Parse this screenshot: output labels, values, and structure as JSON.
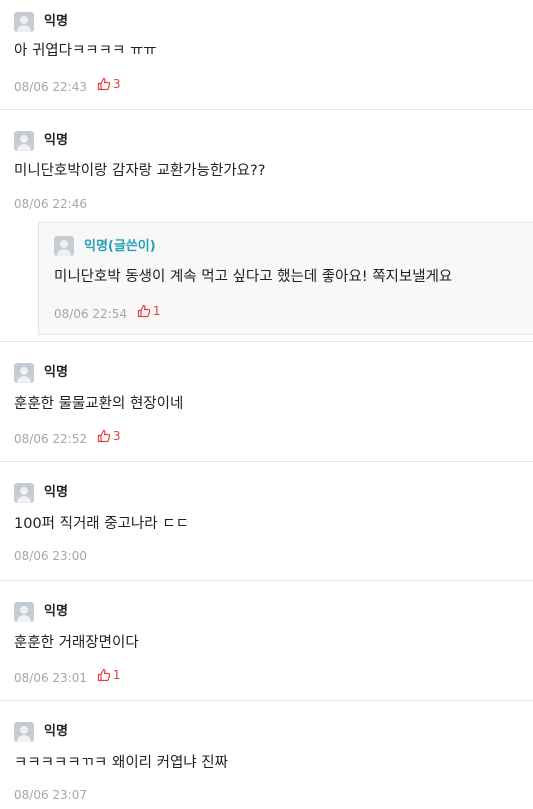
{
  "comments": [
    {
      "name": "익명",
      "text": "아 귀엽다ㅋㅋㅋㅋ ㅠㅠ",
      "date": "08/06 22:43",
      "votes": "3"
    },
    {
      "name": "익명",
      "text": "미니단호박이랑 감자랑 교환가능한가요??",
      "date": "08/06 22:46",
      "votes": ""
    },
    {
      "name": "익명(글쓴이)",
      "text": "미니단호박 동생이 계속 먹고 싶다고 했는데 좋아요! 쪽지보낼게요",
      "date": "08/06 22:54",
      "votes": "1"
    },
    {
      "name": "익명",
      "text": "훈훈한 물물교환의 현장이네",
      "date": "08/06 22:52",
      "votes": "3"
    },
    {
      "name": "익명",
      "text": "100퍼 직거래 중고나라 ㄷㄷ",
      "date": "08/06 23:00",
      "votes": ""
    },
    {
      "name": "익명",
      "text": "훈훈한 거래장면이다",
      "date": "08/06 23:01",
      "votes": "1"
    },
    {
      "name": "익명",
      "text": "ㅋㅋㅋㅋㅋㄲㅋ 왜이리 커엽냐 진짜",
      "date": "08/06 23:07",
      "votes": ""
    }
  ],
  "icons": {
    "avatar": "default-profile-icon",
    "vote": "thumbs-up-icon"
  },
  "colors": {
    "author": "#26a0b6",
    "vote": "#e0423e",
    "meta": "#a6a6a6",
    "divider": "#e6e6e6"
  }
}
